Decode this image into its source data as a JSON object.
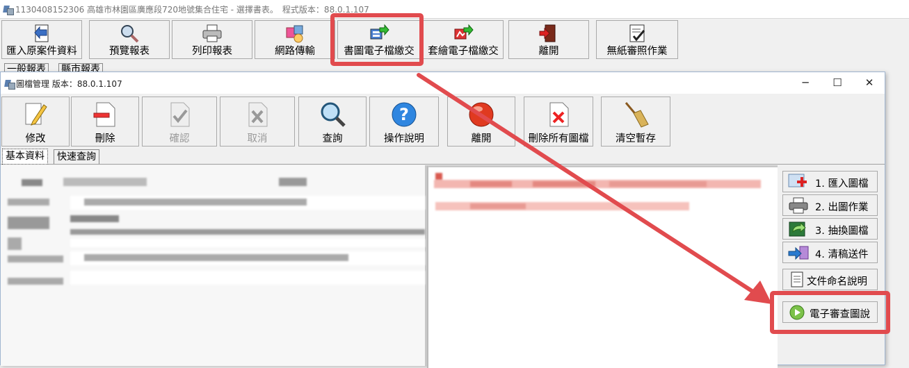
{
  "outer_window": {
    "title": "1130408152306 高雄市林園區廣應段720地號集合住宅 - 選擇書表。　程式版本：88.0.1.107"
  },
  "main_toolbar": {
    "buttons": [
      {
        "label": "匯入原案件資料",
        "icon": "import-arrow-icon"
      },
      {
        "label": "預覽報表",
        "icon": "magnifier-icon"
      },
      {
        "label": "列印報表",
        "icon": "printer-icon"
      },
      {
        "label": "網路傳輸",
        "icon": "network-transfer-icon"
      },
      {
        "label": "書圖電子檔繳交",
        "icon": "document-export-icon"
      },
      {
        "label": "套繪電子檔繳交",
        "icon": "overlay-export-icon"
      },
      {
        "label": "離開",
        "icon": "exit-door-icon"
      },
      {
        "label": "無紙審照作業",
        "icon": "checklist-icon"
      }
    ]
  },
  "outer_tabs": [
    "一般報表",
    "縣市報表"
  ],
  "inner_window": {
    "title": "圖檔管理 版本：88.0.1.107",
    "controls": {
      "minimize": "─",
      "maximize": "☐",
      "close": "✕"
    }
  },
  "inner_toolbar": {
    "buttons": [
      {
        "label": "修改",
        "icon": "pencil-icon",
        "enabled": true
      },
      {
        "label": "刪除",
        "icon": "delete-doc-icon",
        "enabled": true
      },
      {
        "label": "確認",
        "icon": "confirm-icon",
        "enabled": false
      },
      {
        "label": "取消",
        "icon": "cancel-icon",
        "enabled": false
      },
      {
        "label": "查詢",
        "icon": "search-icon",
        "enabled": true
      },
      {
        "label": "操作說明",
        "icon": "help-icon",
        "enabled": true
      },
      {
        "label": "離開",
        "icon": "exit-ball-icon",
        "enabled": true
      },
      {
        "label": "刪除所有圖檔",
        "icon": "delete-all-icon",
        "enabled": true
      },
      {
        "label": "清空暫存",
        "icon": "broom-icon",
        "enabled": true
      }
    ]
  },
  "inner_tabs": [
    "基本資料",
    "快速查詢"
  ],
  "side_buttons": [
    {
      "label": "1. 匯入圖檔",
      "icon": "import-image-icon"
    },
    {
      "label": "2. 出圖作業",
      "icon": "printer-icon"
    },
    {
      "label": "3. 抽換圖檔",
      "icon": "swap-icon"
    },
    {
      "label": "4. 清稿送件",
      "icon": "send-icon"
    },
    {
      "label": "文件命名說明",
      "icon": "document-icon"
    },
    {
      "label": "電子審查圖說",
      "icon": "play-icon"
    }
  ],
  "colors": {
    "highlight": "#e14b4e",
    "background": "#f0f0f0"
  }
}
